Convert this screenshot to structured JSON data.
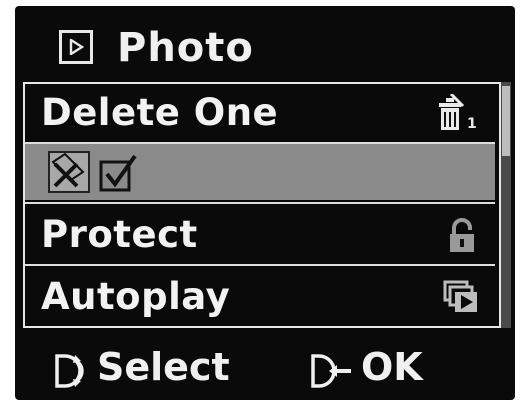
{
  "header": {
    "title": "Photo",
    "icon": "playback-icon"
  },
  "menu": {
    "items": [
      {
        "label": "Delete One",
        "icon": "delete-one-icon",
        "icon_badge": "1"
      },
      {
        "label": "",
        "icon": "options-row",
        "options": [
          "cancel-icon",
          "confirm-icon"
        ],
        "selected": true
      },
      {
        "label": "Protect",
        "icon": "lock-icon"
      },
      {
        "label": "Autoplay",
        "icon": "slideshow-icon"
      }
    ]
  },
  "footer": {
    "select_label": "Select",
    "select_icon": "dial-icon",
    "ok_label": "OK",
    "ok_icon": "press-dial-icon"
  },
  "colors": {
    "background": "#0a0a0a",
    "text": "#f2f2f2",
    "highlight": "#8a8a8a"
  }
}
